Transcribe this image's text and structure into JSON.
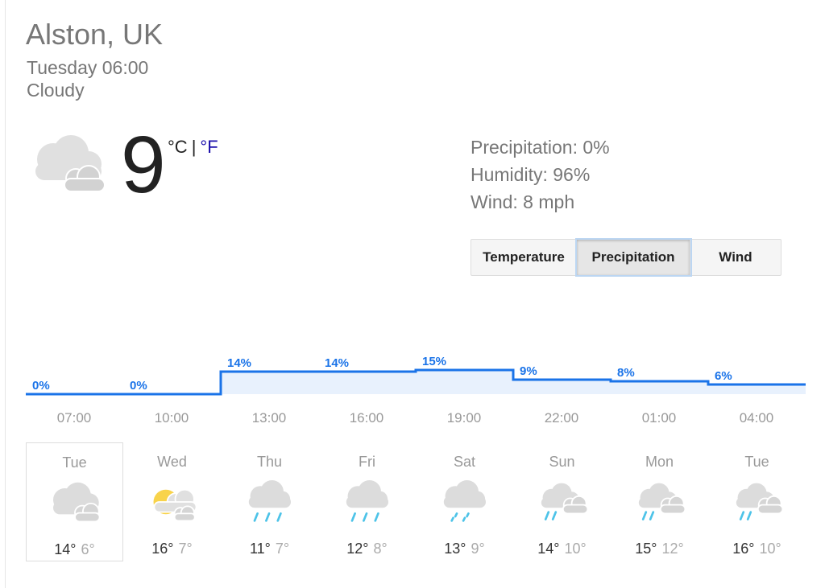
{
  "location": "Alston, UK",
  "datetime": "Tuesday 06:00",
  "condition": "Cloudy",
  "current": {
    "temp": "9",
    "unit_c": "°C",
    "unit_sep": "|",
    "unit_f": "°F",
    "precipitation": "Precipitation: 0%",
    "humidity": "Humidity: 96%",
    "wind": "Wind: 8 mph"
  },
  "tabs": [
    {
      "label": "Temperature",
      "selected": false
    },
    {
      "label": "Precipitation",
      "selected": true
    },
    {
      "label": "Wind",
      "selected": false
    }
  ],
  "chart_data": {
    "type": "area",
    "x": [
      "07:00",
      "10:00",
      "13:00",
      "16:00",
      "19:00",
      "22:00",
      "01:00",
      "04:00"
    ],
    "labels": [
      "0%",
      "0%",
      "14%",
      "14%",
      "15%",
      "9%",
      "8%",
      "6%"
    ],
    "values": [
      0,
      0,
      14,
      14,
      15,
      9,
      8,
      6
    ],
    "color": "#1a73e8"
  },
  "days": [
    {
      "name": "Tue",
      "hi": "14°",
      "lo": "6°",
      "icon": "cloudy-icon",
      "selected": true
    },
    {
      "name": "Wed",
      "hi": "16°",
      "lo": "7°",
      "icon": "partly-sunny-icon",
      "selected": false
    },
    {
      "name": "Thu",
      "hi": "11°",
      "lo": "7°",
      "icon": "rain-icon",
      "selected": false
    },
    {
      "name": "Fri",
      "hi": "12°",
      "lo": "8°",
      "icon": "rain-icon",
      "selected": false
    },
    {
      "name": "Sat",
      "hi": "13°",
      "lo": "9°",
      "icon": "light-rain-icon",
      "selected": false
    },
    {
      "name": "Sun",
      "hi": "14°",
      "lo": "10°",
      "icon": "rain-cloud-icon",
      "selected": false
    },
    {
      "name": "Mon",
      "hi": "15°",
      "lo": "12°",
      "icon": "rain-cloud-icon",
      "selected": false
    },
    {
      "name": "Tue",
      "hi": "16°",
      "lo": "10°",
      "icon": "rain-cloud-icon",
      "selected": false
    }
  ]
}
